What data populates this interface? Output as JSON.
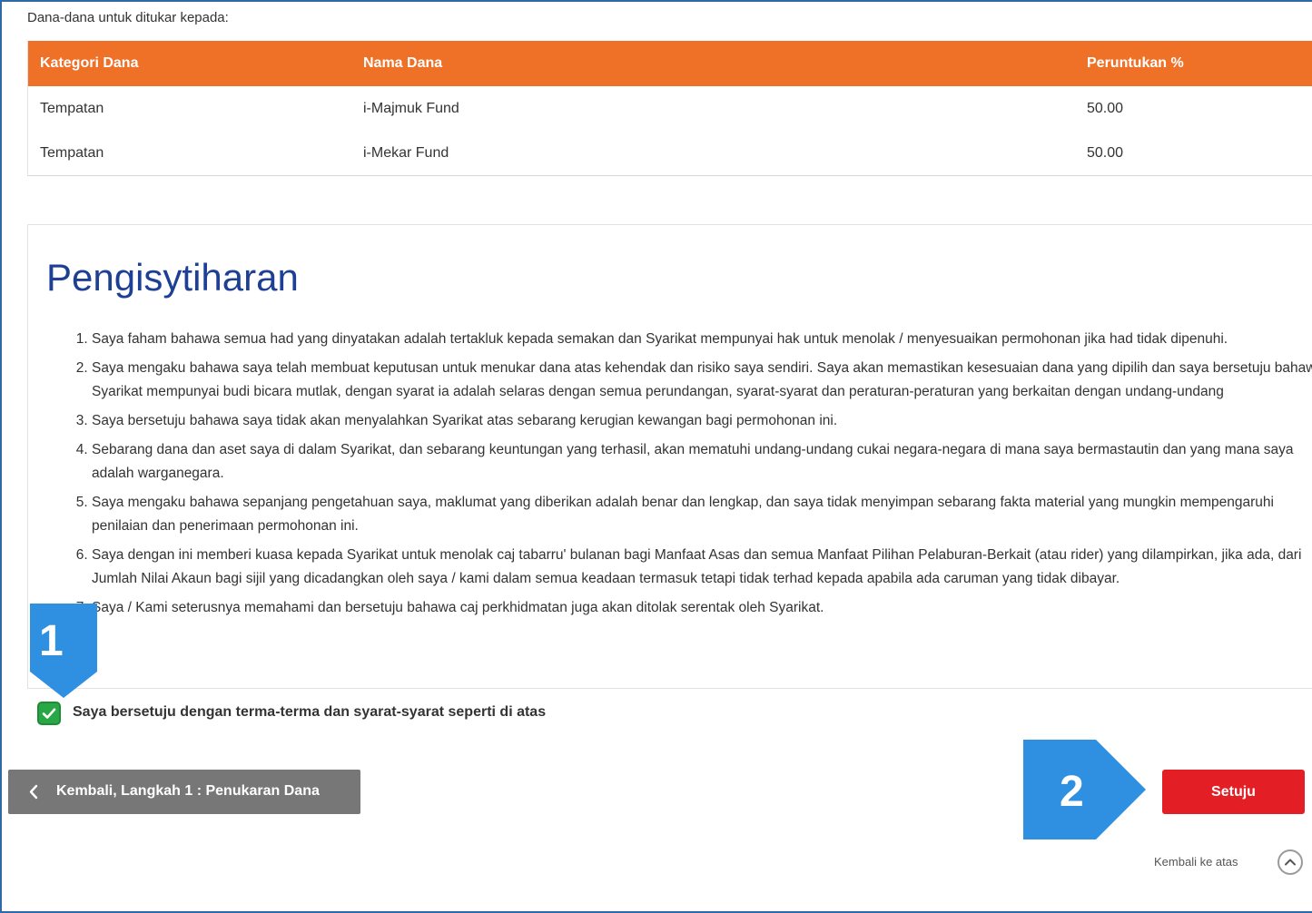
{
  "section_title": "Dana-dana untuk ditukar kepada:",
  "fund_table": {
    "headers": [
      "Kategori Dana",
      "Nama Dana",
      "Peruntukan %"
    ],
    "rows": [
      [
        "Tempatan",
        "i-Majmuk Fund",
        "50.00"
      ],
      [
        "Tempatan",
        "i-Mekar Fund",
        "50.00"
      ]
    ],
    "header_color": "#ee7127"
  },
  "declaration": {
    "title": "Pengisytiharan",
    "items": [
      "Saya faham bahawa semua had yang dinyatakan adalah tertakluk kepada semakan dan Syarikat mempunyai hak untuk menolak / menyesuaikan permohonan jika had tidak dipenuhi.",
      "Saya mengaku bahawa saya telah membuat keputusan untuk menukar dana atas kehendak dan risiko saya sendiri. Saya akan memastikan kesesuaian dana yang dipilih dan saya bersetuju bahawa Syarikat mempunyai budi bicara mutlak, dengan syarat ia adalah selaras dengan semua perundangan, syarat-syarat dan peraturan-peraturan yang berkaitan dengan undang-undang",
      "Saya bersetuju bahawa saya tidak akan menyalahkan Syarikat atas sebarang kerugian kewangan bagi permohonan ini.",
      "Sebarang dana dan aset saya di dalam Syarikat, dan sebarang keuntungan yang terhasil, akan mematuhi undang-undang cukai negara-negara di mana saya bermastautin dan yang mana saya adalah warganegara.",
      "Saya mengaku bahawa sepanjang pengetahuan saya, maklumat yang diberikan adalah benar dan lengkap, dan saya tidak menyimpan sebarang fakta material yang mungkin mempengaruhi penilaian dan penerimaan permohonan ini.",
      "Saya dengan ini memberi kuasa kepada Syarikat untuk menolak caj tabarru' bulanan bagi Manfaat Asas dan semua Manfaat Pilihan Pelaburan-Berkait (atau rider) yang dilampirkan, jika ada, dari Jumlah Nilai Akaun bagi sijil yang dicadangkan oleh saya / kami dalam semua keadaan termasuk tetapi tidak terhad kepada apabila ada caruman yang tidak dibayar.",
      "Saya / Kami seterusnya memahami dan bersetuju bahawa caj perkhidmatan juga akan ditolak serentak oleh Syarikat."
    ]
  },
  "agree_checkbox": {
    "label": "Saya bersetuju dengan terma-terma dan syarat-syarat seperti di atas",
    "checked": true
  },
  "buttons": {
    "back": "Kembali, Langkah 1 : Penukaran Dana",
    "agree": "Setuju"
  },
  "back_to_top": "Kembali ke atas",
  "callouts": {
    "one": "1",
    "two": "2",
    "color": "#2f8fe0"
  }
}
